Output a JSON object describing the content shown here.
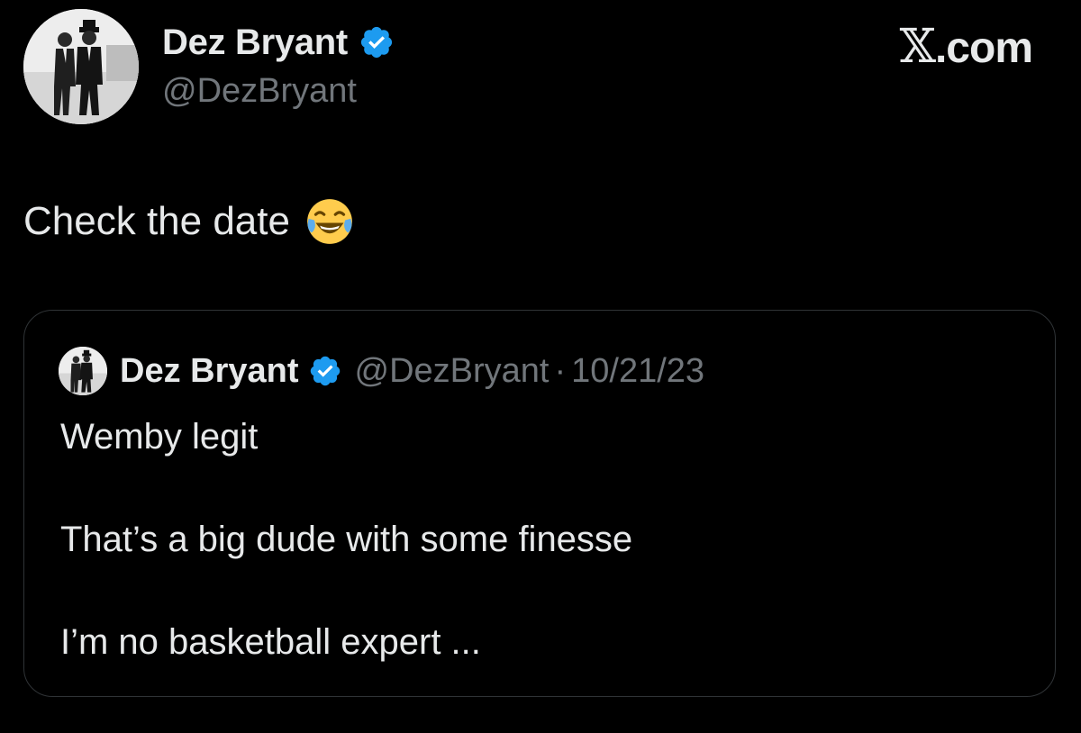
{
  "author": {
    "name": "Dez Bryant",
    "handle": "@DezBryant",
    "verified": true,
    "avatar_icon": "profile-photo"
  },
  "brand": {
    "site": "X.com",
    "x_glyph": "𝕏",
    "suffix": ".com"
  },
  "tweet": {
    "text": "Check the date",
    "emoji_icon": "face-with-tears-of-joy-emoji"
  },
  "quoted_tweet": {
    "author_name": "Dez Bryant",
    "handle": "@DezBryant",
    "separator": "·",
    "date": "10/21/23",
    "lines": [
      "Wemby legit",
      "That’s a big dude with some finesse",
      "I’m no basketball expert ..."
    ]
  },
  "colors": {
    "background": "#000000",
    "text_primary": "#e7e9ea",
    "text_secondary": "#71767b",
    "verified_badge": "#1d9bf0",
    "card_border": "#2f3336"
  }
}
